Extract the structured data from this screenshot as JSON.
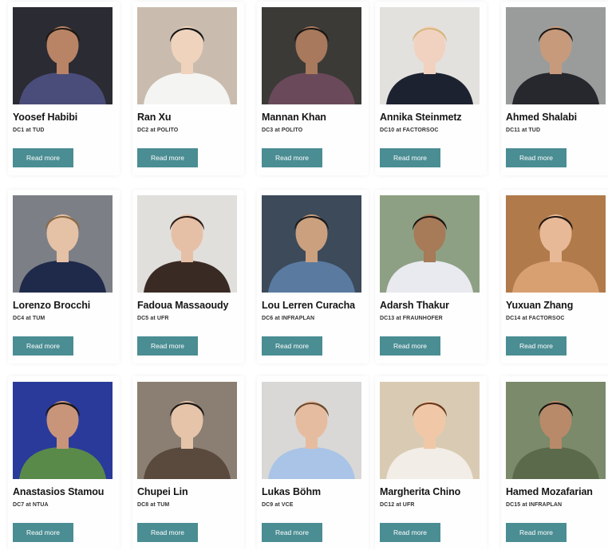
{
  "members": [
    {
      "name": "Yoosef Habibi",
      "role": "DC1 at TUD",
      "button": "Read more",
      "bg": "#2b2b33",
      "skin": "#b98466",
      "hair": "#1e1712",
      "shirt": "#4a4d7a"
    },
    {
      "name": "Ran Xu",
      "role": "DC2 at POLITO",
      "button": "Read more",
      "bg": "#c9bcae",
      "skin": "#f0d3bd",
      "hair": "#141414",
      "shirt": "#f4f4f2"
    },
    {
      "name": "Mannan Khan",
      "role": "DC3 at POLITO",
      "button": "Read more",
      "bg": "#3b3a36",
      "skin": "#a8795c",
      "hair": "#1a1512",
      "shirt": "#6a4a5a"
    },
    {
      "name": "Annika Steinmetz",
      "role": "DC10 at FACTORSOC",
      "button": "Read more",
      "bg": "#e3e1de",
      "skin": "#f1d2c1",
      "hair": "#d6b77c",
      "shirt": "#1d2230"
    },
    {
      "name": "Ahmed Shalabi",
      "role": "DC11 at TUD",
      "button": "Read more",
      "bg": "#9a9c9c",
      "skin": "#c79a7c",
      "hair": "#1c1814",
      "shirt": "#26282d"
    },
    {
      "name": "Lorenzo Brocchi",
      "role": "DC4 at TUM",
      "button": "Read more",
      "bg": "#7c7f86",
      "skin": "#e5c1a6",
      "hair": "#8a6a44",
      "shirt": "#1f2a4a"
    },
    {
      "name": "Fadoua Massaoudy",
      "role": "DC5 at UFR",
      "button": "Read more",
      "bg": "#e1dfdc",
      "skin": "#e6c0a6",
      "hair": "#2a1a14",
      "shirt": "#3a2a24"
    },
    {
      "name": "Lou Lerren Curacha",
      "role": "DC6 at INFRAPLAN",
      "button": "Read more",
      "bg": "#3c4a5a",
      "skin": "#caa07e",
      "hair": "#1a1a1a",
      "shirt": "#5a7aa0"
    },
    {
      "name": "Adarsh Thakur",
      "role": "DC13 at FRAUNHOFER",
      "button": "Read more",
      "bg": "#8ea083",
      "skin": "#a77a58",
      "hair": "#1a1410",
      "shirt": "#e8eaf0"
    },
    {
      "name": "Yuxuan Zhang",
      "role": "DC14 at FACTORSOC",
      "button": "Read more",
      "bg": "#b07a4a",
      "skin": "#e8b996",
      "hair": "#1e1612",
      "shirt": "#d8a070"
    },
    {
      "name": "Anastasios Stamou",
      "role": "DC7 at NTUA",
      "button": "Read more",
      "bg": "#2a3a9a",
      "skin": "#c8957a",
      "hair": "#1a1410",
      "shirt": "#5a8a4a"
    },
    {
      "name": "Chupei Lin",
      "role": "DC8 at TUM",
      "button": "Read more",
      "bg": "#8a7f72",
      "skin": "#e6c4aa",
      "hair": "#1a1614",
      "shirt": "#5a4a3e"
    },
    {
      "name": "Lukas Böhm",
      "role": "DC9 at VCE",
      "button": "Read more",
      "bg": "#d9d8d6",
      "skin": "#e6bca0",
      "hair": "#6a4a2e",
      "shirt": "#a9c4e6"
    },
    {
      "name": "Margherita Chino",
      "role": "DC12 at UFR",
      "button": "Read more",
      "bg": "#d9cbb3",
      "skin": "#f0c8a8",
      "hair": "#6a3a1e",
      "shirt": "#f2ede6"
    },
    {
      "name": "Hamed Mozafarian",
      "role": "DC15 at INFRAPLAN",
      "button": "Read more",
      "bg": "#7a8a6a",
      "skin": "#b88a6a",
      "hair": "#1a1410",
      "shirt": "#5a6a4a"
    }
  ]
}
